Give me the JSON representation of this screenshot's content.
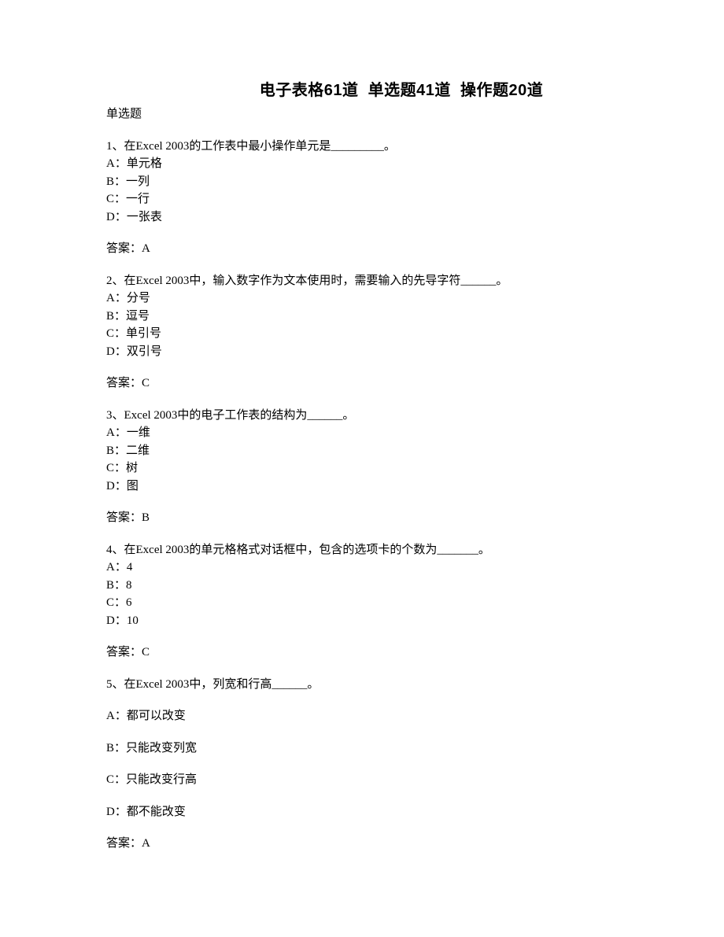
{
  "title": "电子表格61道  单选题41道  操作题20道",
  "section_label": "单选题",
  "answer_prefix": "答案：",
  "questions": [
    {
      "stem": "1、在Excel 2003的工作表中最小操作单元是_________。",
      "opts": [
        "A：单元格",
        "B：一列",
        "C：一行",
        "D：一张表"
      ],
      "answer": "A",
      "spaced": false
    },
    {
      "stem": "2、在Excel 2003中，输入数字作为文本使用时，需要输入的先导字符______。",
      "opts": [
        "A：分号",
        "B：逗号",
        "C：单引号",
        "D：双引号"
      ],
      "answer": "C",
      "spaced": false
    },
    {
      "stem": "3、Excel 2003中的电子工作表的结构为______。",
      "opts": [
        "A：一维",
        "B：二维",
        "C：树",
        "D：图"
      ],
      "answer": "B",
      "spaced": false
    },
    {
      "stem": "4、在Excel 2003的单元格格式对话框中，包含的选项卡的个数为_______。",
      "opts": [
        "A：4",
        "B：8",
        "C：6",
        "D：10"
      ],
      "answer": "C",
      "spaced": false
    },
    {
      "stem": "5、在Excel 2003中，列宽和行高______。",
      "opts": [
        "A：都可以改变",
        "B：只能改变列宽",
        "C：只能改变行高",
        "D：都不能改变"
      ],
      "answer": "A",
      "spaced": true
    }
  ]
}
